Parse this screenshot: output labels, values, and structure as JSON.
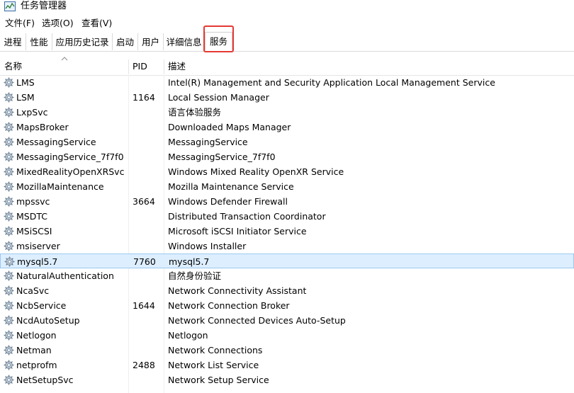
{
  "window": {
    "title": "任务管理器"
  },
  "menu": [
    {
      "label": "文件(F)"
    },
    {
      "label": "选项(O)"
    },
    {
      "label": "查看(V)"
    }
  ],
  "tabs": [
    {
      "label": "进程"
    },
    {
      "label": "性能"
    },
    {
      "label": "应用历史记录"
    },
    {
      "label": "启动"
    },
    {
      "label": "用户"
    },
    {
      "label": "详细信息"
    },
    {
      "label": "服务",
      "active": true
    }
  ],
  "columns": {
    "name": "名称",
    "pid": "PID",
    "desc": "描述"
  },
  "services": [
    {
      "name": "LMS",
      "pid": "",
      "desc": "Intel(R) Management and Security Application Local Management Service"
    },
    {
      "name": "LSM",
      "pid": "1164",
      "desc": "Local Session Manager"
    },
    {
      "name": "LxpSvc",
      "pid": "",
      "desc": "语言体验服务"
    },
    {
      "name": "MapsBroker",
      "pid": "",
      "desc": "Downloaded Maps Manager"
    },
    {
      "name": "MessagingService",
      "pid": "",
      "desc": "MessagingService"
    },
    {
      "name": "MessagingService_7f7f0",
      "pid": "",
      "desc": "MessagingService_7f7f0"
    },
    {
      "name": "MixedRealityOpenXRSvc",
      "pid": "",
      "desc": "Windows Mixed Reality OpenXR Service"
    },
    {
      "name": "MozillaMaintenance",
      "pid": "",
      "desc": "Mozilla Maintenance Service"
    },
    {
      "name": "mpssvc",
      "pid": "3664",
      "desc": "Windows Defender Firewall"
    },
    {
      "name": "MSDTC",
      "pid": "",
      "desc": "Distributed Transaction Coordinator"
    },
    {
      "name": "MSiSCSI",
      "pid": "",
      "desc": "Microsoft iSCSI Initiator Service"
    },
    {
      "name": "msiserver",
      "pid": "",
      "desc": "Windows Installer"
    },
    {
      "name": "mysql5.7",
      "pid": "7760",
      "desc": "mysql5.7",
      "selected": true
    },
    {
      "name": "NaturalAuthentication",
      "pid": "",
      "desc": "自然身份验证"
    },
    {
      "name": "NcaSvc",
      "pid": "",
      "desc": "Network Connectivity Assistant"
    },
    {
      "name": "NcbService",
      "pid": "1644",
      "desc": "Network Connection Broker"
    },
    {
      "name": "NcdAutoSetup",
      "pid": "",
      "desc": "Network Connected Devices Auto-Setup"
    },
    {
      "name": "Netlogon",
      "pid": "",
      "desc": "Netlogon"
    },
    {
      "name": "Netman",
      "pid": "",
      "desc": "Network Connections"
    },
    {
      "name": "netprofm",
      "pid": "2488",
      "desc": "Network List Service"
    },
    {
      "name": "NetSetupSvc",
      "pid": "",
      "desc": "Network Setup Service"
    }
  ]
}
